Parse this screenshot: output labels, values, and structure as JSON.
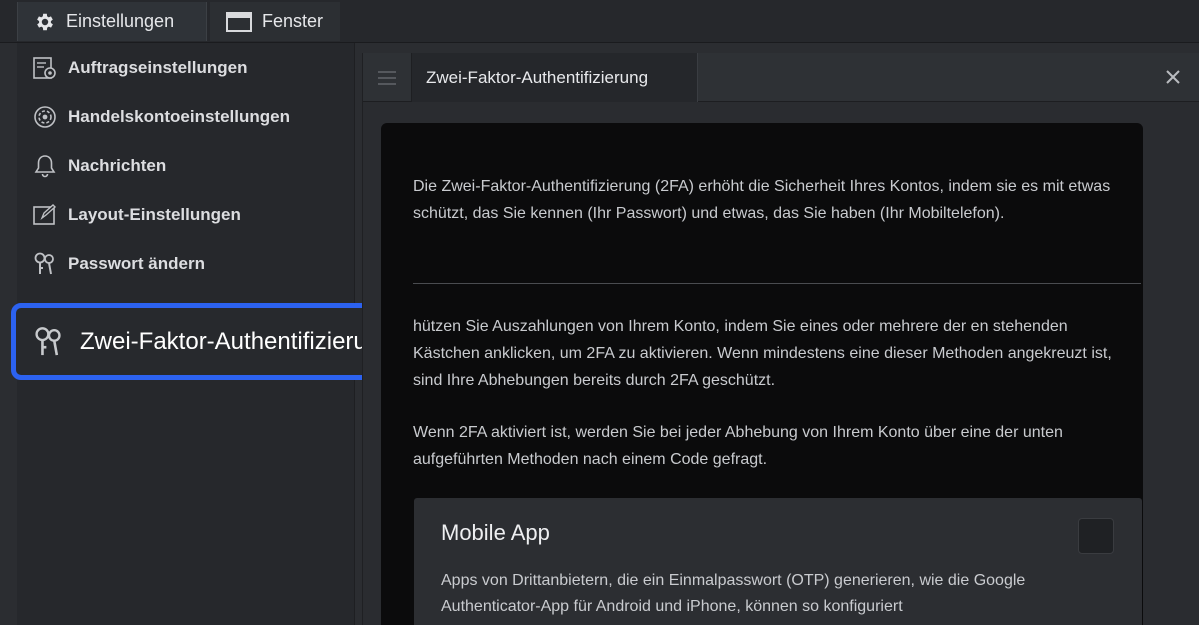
{
  "topbar": {
    "settings_label": "Einstellungen",
    "window_label": "Fenster"
  },
  "menu": {
    "items": [
      {
        "label": "Auftragseinstellungen",
        "icon": "order-settings-icon"
      },
      {
        "label": "Handelskontoeinstellungen",
        "icon": "account-gear-icon"
      },
      {
        "label": "Nachrichten",
        "icon": "bell-icon"
      },
      {
        "label": "Layout-Einstellungen",
        "icon": "layout-edit-icon"
      },
      {
        "label": "Passwort ändern",
        "icon": "keys-icon"
      }
    ],
    "highlighted": {
      "label": "Zwei-Faktor-Authentifizierung",
      "icon": "keys-icon"
    }
  },
  "panel": {
    "tab_title": "Zwei-Faktor-Authentifizierung",
    "intro": "Die Zwei-Faktor-Authentifizierung (2FA) erhöht die Sicherheit Ihres Kontos, indem sie es mit etwas schützt, das Sie kennen (Ihr Passwort) und etwas, das Sie haben (Ihr Mobiltelefon).",
    "protect_text": "hützen Sie Auszahlungen von Ihrem Konto, indem Sie eines oder mehrere der en stehenden Kästchen anklicken, um 2FA zu aktivieren. Wenn mindestens eine dieser Methoden angekreuzt ist, sind Ihre Abhebungen bereits durch 2FA geschützt.",
    "code_text": "Wenn 2FA aktiviert ist, werden Sie bei jeder Abhebung von Ihrem Konto über eine der unten aufgeführten Methoden nach einem Code gefragt.",
    "card": {
      "title": "Mobile App",
      "checked": false,
      "text": "Apps von Drittanbietern, die ein Einmalpasswort (OTP) generieren, wie die Google Authenticator-App für Android und iPhone, können so konfiguriert"
    }
  },
  "colors": {
    "highlight_border": "#2c62f0",
    "background": "#2b2d31",
    "content_bg": "#0b0b0c"
  }
}
